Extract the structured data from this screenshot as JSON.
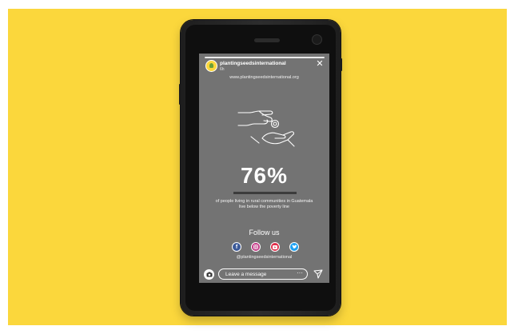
{
  "colors": {
    "background": "#fbd73c",
    "screen": "#737373",
    "accent_bar": "#3c3c3c",
    "facebook": "#3b5998",
    "instagram": "#c13584",
    "youtube": "#e02f4b",
    "twitter": "#1da1f2"
  },
  "story": {
    "progress": 1.0,
    "username": "plantingseedsinternational",
    "time": "6h",
    "website": "www.plantingseedsinternational.org",
    "illustration_icon": "hands-giving-icon",
    "stat_value": "76%",
    "description": "of people living in rural communities in Guatemala live below the poverty line",
    "follow_title": "Follow us",
    "social_icons": [
      "facebook-icon",
      "instagram-icon",
      "youtube-icon",
      "twitter-icon"
    ],
    "handle": "@plantingseedsinternational"
  },
  "footer": {
    "message_placeholder": "Leave a message",
    "more_icon": "ellipsis-icon",
    "send_icon": "send-icon",
    "camera_icon": "camera-icon"
  }
}
